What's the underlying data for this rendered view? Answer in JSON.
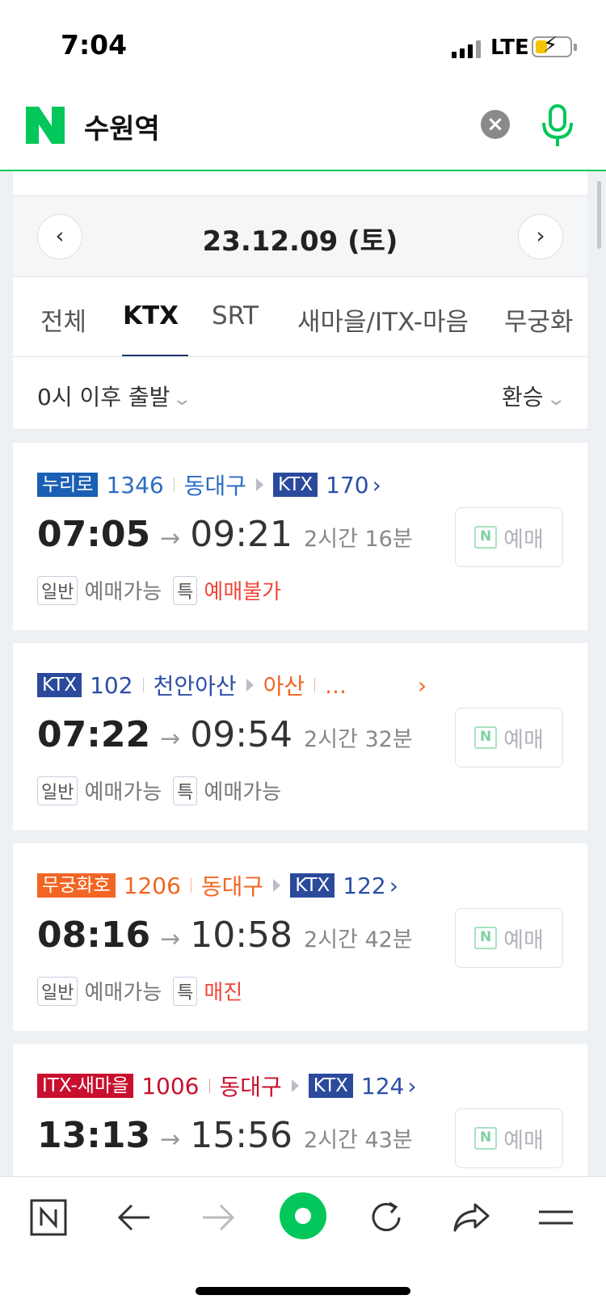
{
  "status_bar": {
    "time": "7:04",
    "network": "LTE"
  },
  "search": {
    "query": "수원역"
  },
  "date_nav": {
    "date": "23.12.09 (토)"
  },
  "tabs": [
    {
      "label": "전체",
      "active": false
    },
    {
      "label": "KTX",
      "active": true
    },
    {
      "label": "SRT",
      "active": false
    },
    {
      "label": "새마을/ITX-마음",
      "active": false
    },
    {
      "label": "무궁화",
      "active": false
    }
  ],
  "filters": {
    "departure": "0시 이후 출발",
    "transfer": "환승"
  },
  "trains": [
    {
      "type": "누리로",
      "type_color": "#1a5fb4",
      "number": "1346",
      "number_color": "#2c6cc4",
      "via": "동대구",
      "via_color": "#2c6cc4",
      "transfer_type": "KTX",
      "transfer_color": "#2b4a9c",
      "transfer_number": "170",
      "transfer_number_color": "#2c4ea8",
      "departure": "07:05",
      "arrival": "09:21",
      "duration": "2시간 16분",
      "seats": [
        {
          "type": "일반",
          "status": "예매가능",
          "red": false
        },
        {
          "type": "특",
          "status": "예매불가",
          "red": true
        }
      ],
      "book_label": "예매"
    },
    {
      "type": "KTX",
      "type_color": "#2b4a9c",
      "number": "102",
      "number_color": "#2c4ea8",
      "via": "천안아산",
      "via_color": "#2c4ea8",
      "via2": "아산",
      "via2_color": "#f26522",
      "more": "...",
      "departure": "07:22",
      "arrival": "09:54",
      "duration": "2시간 32분",
      "seats": [
        {
          "type": "일반",
          "status": "예매가능",
          "red": false
        },
        {
          "type": "특",
          "status": "예매가능",
          "red": false
        }
      ],
      "book_label": "예매"
    },
    {
      "type": "무궁화호",
      "type_color": "#f26522",
      "number": "1206",
      "number_color": "#f26522",
      "via": "동대구",
      "via_color": "#f26522",
      "transfer_type": "KTX",
      "transfer_color": "#2b4a9c",
      "transfer_number": "122",
      "transfer_number_color": "#2c4ea8",
      "departure": "08:16",
      "arrival": "10:58",
      "duration": "2시간 42분",
      "seats": [
        {
          "type": "일반",
          "status": "예매가능",
          "red": false
        },
        {
          "type": "특",
          "status": "매진",
          "red": true
        }
      ],
      "book_label": "예매"
    },
    {
      "type": "ITX-새마을",
      "type_color": "#c8102e",
      "number": "1006",
      "number_color": "#c8102e",
      "via": "동대구",
      "via_color": "#c8102e",
      "transfer_type": "KTX",
      "transfer_color": "#2b4a9c",
      "transfer_number": "124",
      "transfer_number_color": "#2c4ea8",
      "departure": "13:13",
      "arrival": "15:56",
      "duration": "2시간 43분",
      "seats": [],
      "book_label": "예매"
    }
  ],
  "colors": {
    "naver_green": "#03c75a",
    "tab_active_underline": "#1e3a70",
    "sold_out_red": "#f0453a"
  },
  "toolbar": {
    "icons": [
      "naver-home-icon",
      "back-arrow-icon",
      "forward-arrow-icon",
      "green-dot-icon",
      "refresh-icon",
      "share-icon",
      "menu-icon"
    ]
  }
}
